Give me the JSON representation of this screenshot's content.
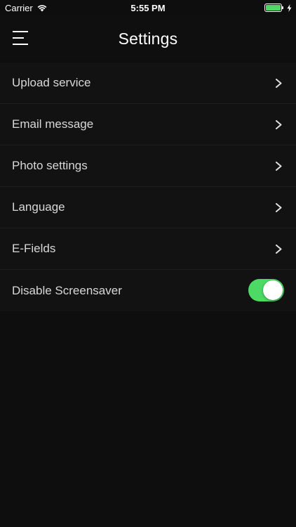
{
  "status_bar": {
    "carrier": "Carrier",
    "time": "5:55 PM",
    "battery_level": 1.0,
    "battery_color": "#4cd964",
    "icons": [
      "wifi-icon",
      "battery-icon",
      "charging-bolt-icon"
    ]
  },
  "nav": {
    "title": "Settings",
    "menu_icon": "hamburger-menu-icon"
  },
  "settings": {
    "items": [
      {
        "label": "Upload service",
        "accessory": "chevron-right-icon"
      },
      {
        "label": "Email message",
        "accessory": "chevron-right-icon"
      },
      {
        "label": "Photo settings",
        "accessory": "chevron-right-icon"
      },
      {
        "label": "Language",
        "accessory": "chevron-right-icon"
      },
      {
        "label": "E-Fields",
        "accessory": "chevron-right-icon"
      },
      {
        "label": "Disable Screensaver",
        "accessory": "toggle",
        "toggle_on": true
      }
    ],
    "toggle_on_color": "#4cd964"
  }
}
